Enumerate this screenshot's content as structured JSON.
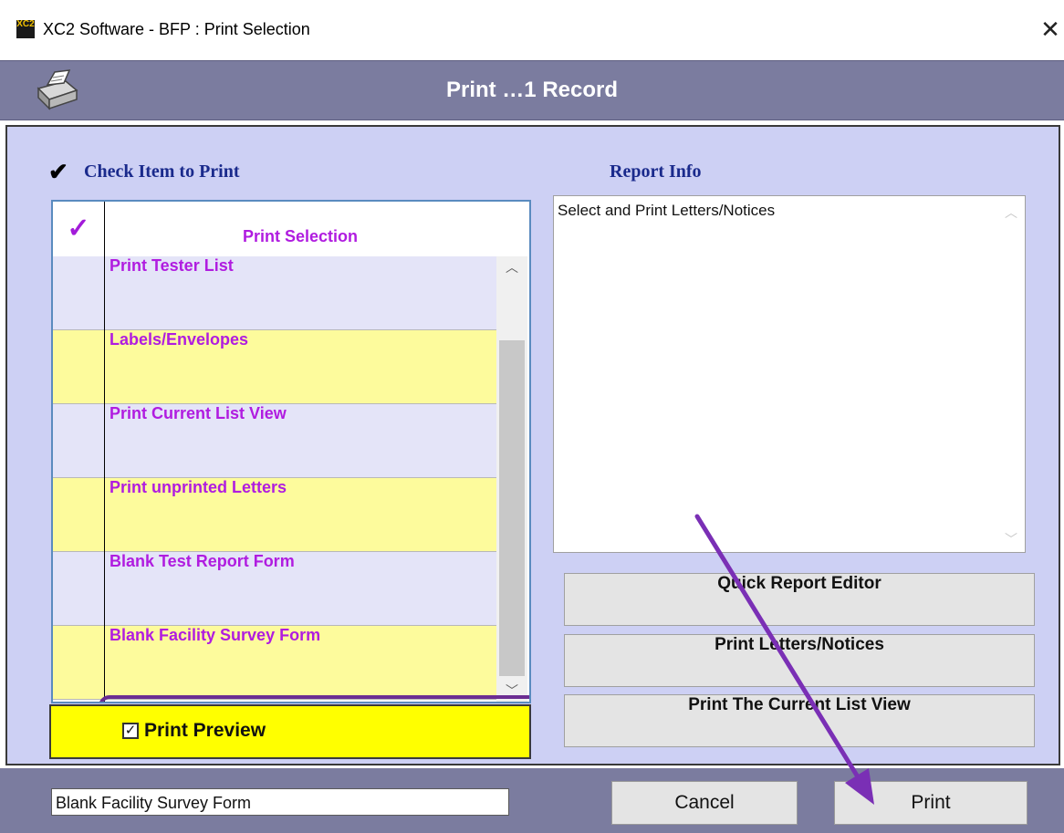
{
  "window": {
    "title": "XC2 Software - BFP : Print Selection",
    "app_icon_text": "XC2",
    "close_glyph": "✕"
  },
  "header": {
    "title": "Print …1 Record",
    "icon": "printer-icon"
  },
  "left_panel": {
    "heading": "Check Item to Print",
    "heading_glyph": "✔",
    "grid": {
      "check_column_glyph": "✓",
      "column_header": "Print Selection",
      "rows": [
        {
          "label": "Print Tester List",
          "bg": "lavender"
        },
        {
          "label": "Labels/Envelopes",
          "bg": "yellow"
        },
        {
          "label": "Print Current List View",
          "bg": "lavender"
        },
        {
          "label": "Print unprinted Letters",
          "bg": "yellow"
        },
        {
          "label": "Blank Test Report Form",
          "bg": "lavender"
        },
        {
          "label": "Blank Facility  Survey Form",
          "bg": "yellow",
          "highlighted": true
        }
      ]
    },
    "print_preview": {
      "label": "Print Preview",
      "checked": true
    }
  },
  "right_panel": {
    "heading": "Report Info",
    "info_text": "Select and Print Letters/Notices",
    "buttons": [
      {
        "label": "Quick Report Editor"
      },
      {
        "label": "Print Letters/Notices"
      },
      {
        "label": "Print The Current List View"
      }
    ]
  },
  "bottom_bar": {
    "status_value": "Blank Facility Survey Form",
    "cancel_label": "Cancel",
    "print_label": "Print"
  },
  "colors": {
    "header_bg": "#7b7c9f",
    "panel_bg": "#cdd0f4",
    "row_text": "#b01ce0",
    "heading_text": "#1a2a8c",
    "highlight_border": "#6b2d92",
    "preview_bg": "#ffff00"
  }
}
